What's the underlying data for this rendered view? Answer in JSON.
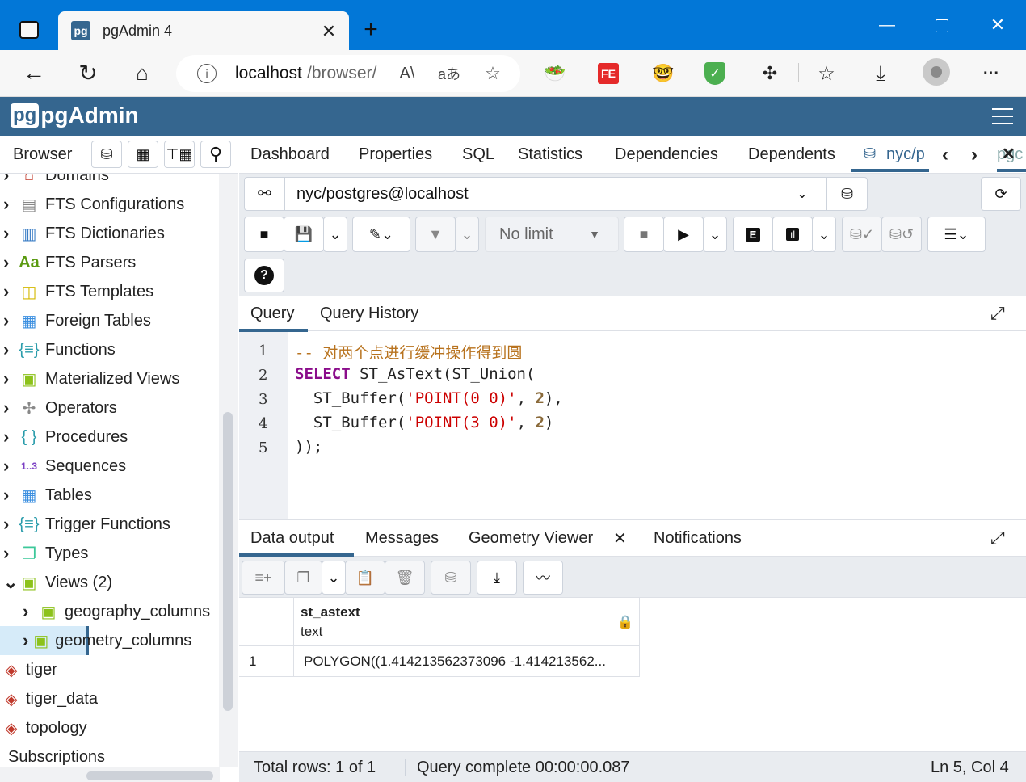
{
  "browser": {
    "tab_title": "pgAdmin 4",
    "url_host": "localhost",
    "url_path": "/browser/",
    "tab_favicon_text": "pg",
    "colors": {
      "titlebar": "#0277d7"
    }
  },
  "app": {
    "logo": "pgAdmin",
    "header_color": "#35668f"
  },
  "left_panel": {
    "title": "Browser",
    "items": [
      {
        "label": "Domains",
        "icon": "domains-icon"
      },
      {
        "label": "FTS Configurations",
        "icon": "fts-configurations-icon"
      },
      {
        "label": "FTS Dictionaries",
        "icon": "fts-dictionaries-icon"
      },
      {
        "label": "FTS Parsers",
        "icon": "fts-parsers-icon",
        "icon_text": "Aa"
      },
      {
        "label": "FTS Templates",
        "icon": "fts-templates-icon"
      },
      {
        "label": "Foreign Tables",
        "icon": "foreign-tables-icon"
      },
      {
        "label": "Functions",
        "icon": "functions-icon",
        "icon_text": "{≡}"
      },
      {
        "label": "Materialized Views",
        "icon": "materialized-views-icon"
      },
      {
        "label": "Operators",
        "icon": "operators-icon"
      },
      {
        "label": "Procedures",
        "icon": "procedures-icon",
        "icon_text": "{ }"
      },
      {
        "label": "Sequences",
        "icon": "sequences-icon",
        "icon_text": "1..3"
      },
      {
        "label": "Tables",
        "icon": "tables-icon"
      },
      {
        "label": "Trigger Functions",
        "icon": "trigger-functions-icon",
        "icon_text": "{≡}"
      },
      {
        "label": "Types",
        "icon": "types-icon"
      },
      {
        "label": "Views (2)",
        "icon": "views-icon"
      },
      {
        "label": "geography_columns",
        "icon": "view-icon"
      },
      {
        "label": "geometry_columns",
        "icon": "view-icon",
        "selected": true
      },
      {
        "label": "tiger",
        "icon": "schema-icon"
      },
      {
        "label": "tiger_data",
        "icon": "schema-icon"
      },
      {
        "label": "topology",
        "icon": "schema-icon"
      },
      {
        "label": "Subscriptions",
        "icon": "subscriptions-icon"
      }
    ]
  },
  "main_tabs": [
    "Dashboard",
    "Properties",
    "SQL",
    "Statistics",
    "Dependencies",
    "Dependents",
    "nyc/p",
    "pgc"
  ],
  "connection": {
    "value": "nyc/postgres@localhost"
  },
  "toolbar": {
    "limit": "No limit",
    "help": "?",
    "explain": "E"
  },
  "query_tabs": [
    "Query",
    "Query History"
  ],
  "editor": {
    "line_numbers": [
      "1",
      "2",
      "3",
      "4",
      "5"
    ],
    "comment": "-- 对两个点进行缓冲操作得到圆",
    "l2_kw": "SELECT",
    "l2_rest": " ST_AsText(ST_Union(",
    "l3_a": "  ST_Buffer(",
    "l3_str": "'POINT(0 0)'",
    "l3_b": ", ",
    "l3_num": "2",
    "l3_c": "),",
    "l4_a": "  ST_Buffer(",
    "l4_str": "'POINT(3 0)'",
    "l4_b": ", ",
    "l4_num": "2",
    "l4_c": ")",
    "l5": "));"
  },
  "result_tabs": [
    "Data output",
    "Messages",
    "Geometry Viewer",
    "Notifications"
  ],
  "grid": {
    "column": "st_astext",
    "type": "text",
    "rows": [
      {
        "num": "1",
        "value": "POLYGON((1.414213562373096 -1.414213562..."
      }
    ]
  },
  "status": {
    "rows": "Total rows: 1 of 1",
    "query": "Query complete 00:00:00.087",
    "position": "Ln 5, Col 4"
  }
}
